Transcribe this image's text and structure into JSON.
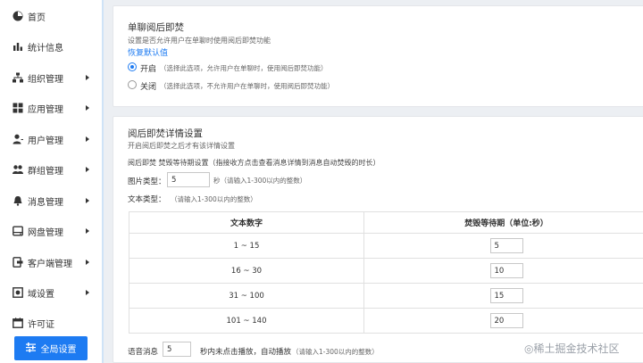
{
  "sidebar": {
    "items": [
      {
        "label": "首页"
      },
      {
        "label": "统计信息"
      },
      {
        "label": "组织管理"
      },
      {
        "label": "应用管理"
      },
      {
        "label": "用户管理"
      },
      {
        "label": "群组管理"
      },
      {
        "label": "消息管理"
      },
      {
        "label": "网盘管理"
      },
      {
        "label": "客户端管理"
      },
      {
        "label": "域设置"
      },
      {
        "label": "许可证"
      }
    ],
    "global_settings_label": "全局设置"
  },
  "card1": {
    "title": "单聊阅后即焚",
    "description": "设置是否允许用户在单聊时使用阅后即焚功能",
    "restore_link": "恢复默认值",
    "options": [
      {
        "label": "开启",
        "note": "（选择此选项，允许用户在单聊时，使用阅后即焚功能）",
        "selected": true
      },
      {
        "label": "关闭",
        "note": "（选择此选项，不允许用户在单聊时，使用阅后即焚功能）",
        "selected": false
      }
    ]
  },
  "card2": {
    "title": "阅后即焚详情设置",
    "description": "开启阅后即焚之后才有该详情设置",
    "wait_setting": "阅后即焚 焚毁等待期设置（指接收方点击查看消息详情到消息自动焚毁的时长）",
    "image_type_label": "图片类型：",
    "image_value": "5",
    "image_unit": "秒（请输入1-300以内的整数）",
    "text_type_label": "文本类型：",
    "text_type_note": "（请输入1-300以内的整数）",
    "table": {
      "headers": [
        "文本数字",
        "焚毁等待期（单位:秒）"
      ],
      "rows": [
        {
          "range": "1 ~ 15",
          "value": "5"
        },
        {
          "range": "16 ~ 30",
          "value": "10"
        },
        {
          "range": "31 ~ 100",
          "value": "15"
        },
        {
          "range": "101 ~ 140",
          "value": "20"
        }
      ]
    },
    "voice_label": "语音消息",
    "voice_value": "5",
    "voice_note": "秒内未点击播放，自动播放",
    "voice_hint": "（请输入1-300以内的整数）"
  },
  "watermark": "◎稀土掘金技术社区",
  "colors": {
    "accent": "#1d7bf2",
    "sidebar_border": "#cfe3f7",
    "background": "#eceff3"
  }
}
